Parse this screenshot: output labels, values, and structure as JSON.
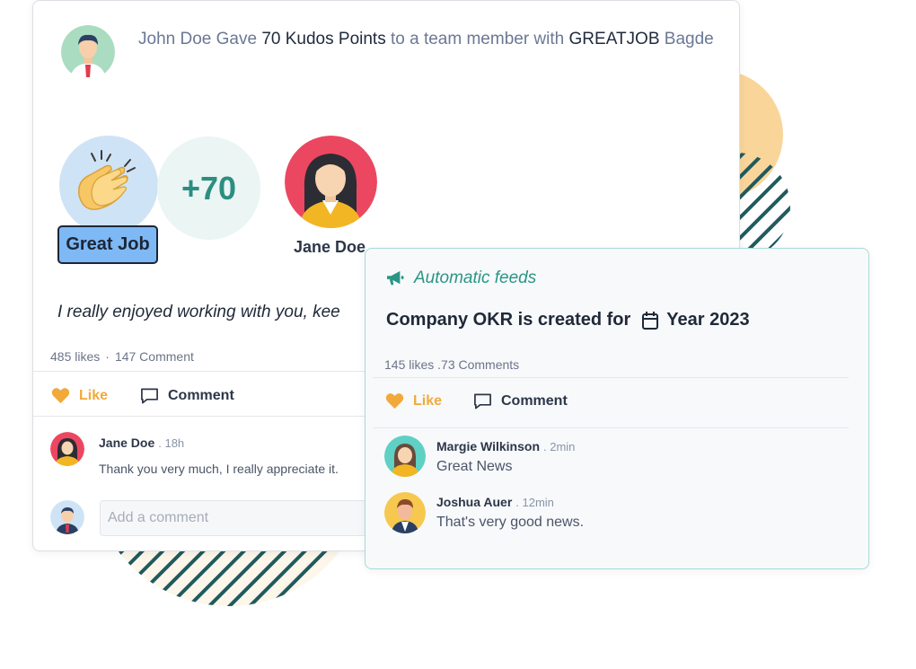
{
  "post": {
    "giver": "John Doe",
    "gave_word": "Gave",
    "points_text": "70 Kudos Points",
    "middle_text": "to a team member with",
    "badge_code": "GREATJOB",
    "badge_word": "Bagde",
    "points_display": "+70",
    "badge_label": "Great Job",
    "recipient": "Jane Doe",
    "message": "I really enjoyed working with you, kee",
    "likes": "485 likes",
    "comments": "147 Comment",
    "like_label": "Like",
    "comment_label": "Comment",
    "comment": {
      "author": "Jane Doe",
      "time": ". 18h",
      "text": "Thank you very much, I really appreciate it."
    },
    "add_comment_placeholder": "Add a comment"
  },
  "feed": {
    "title": "Automatic feeds",
    "okr_text": "Company OKR is created for",
    "year": "Year 2023",
    "stats": "145  likes .73 Comments",
    "like_label": "Like",
    "comment_label": "Comment",
    "comments": [
      {
        "author": "Margie Wilkinson",
        "time": ". 2min",
        "text": "Great News"
      },
      {
        "author": "Joshua Auer",
        "time": ". 12min",
        "text": "That's very good news."
      }
    ]
  },
  "colors": {
    "accent_teal": "#2b9585",
    "like_orange": "#f1a93a",
    "badge_blue": "#7eb8f5"
  },
  "icons": [
    "heart-icon",
    "comment-icon",
    "megaphone-icon",
    "calendar-icon",
    "clapping-hands-icon"
  ]
}
